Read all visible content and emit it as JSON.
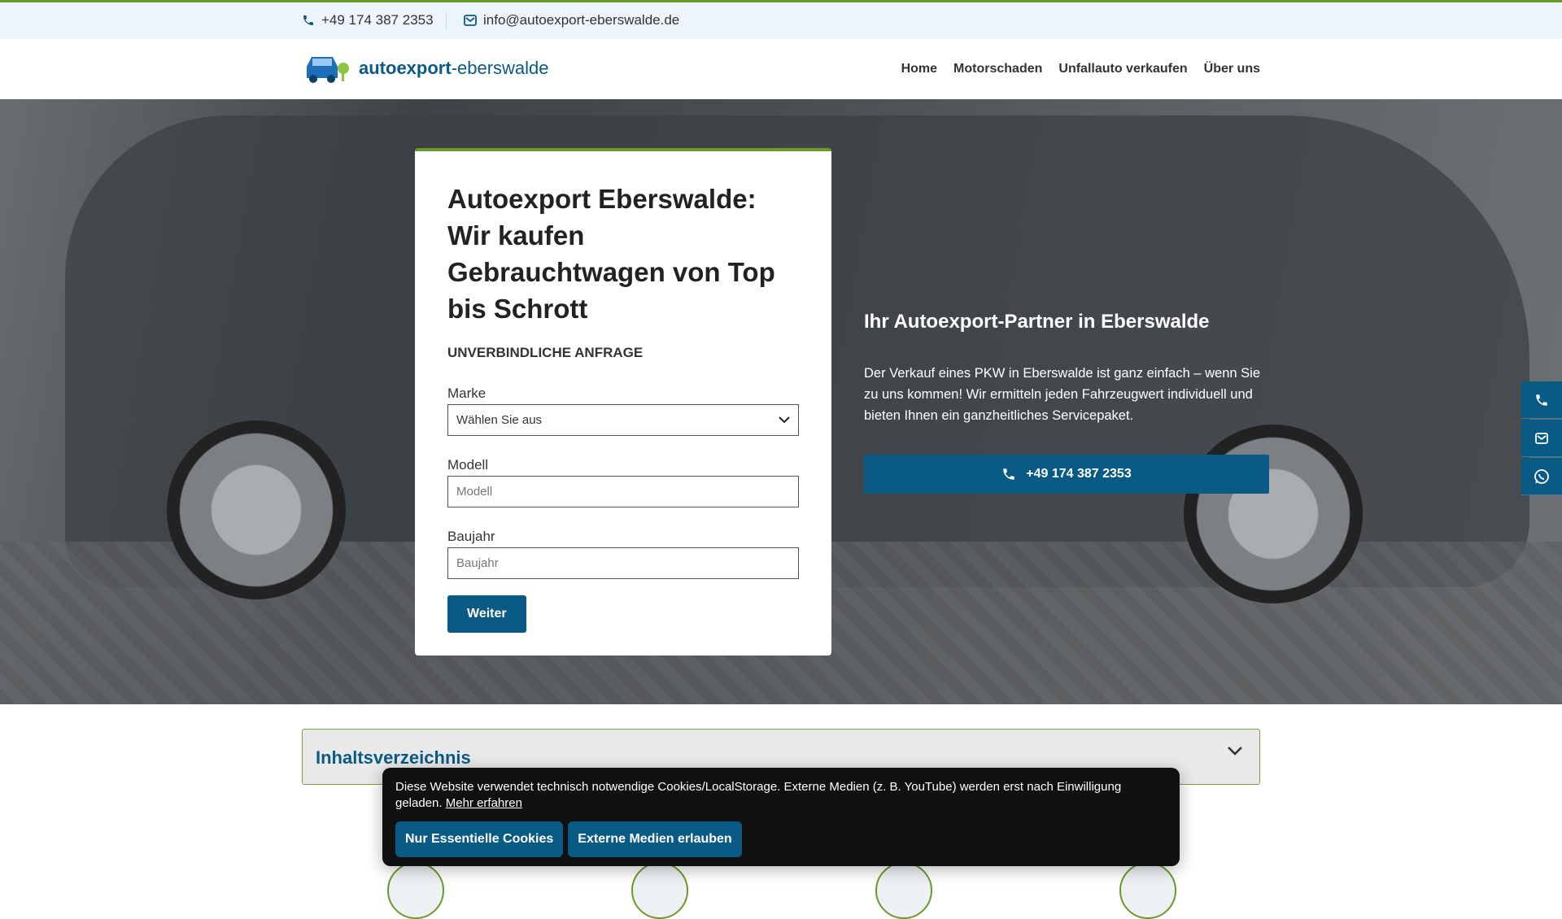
{
  "topbar": {
    "phone": "+49 174 387 2353",
    "email": "info@autoexport-eberswalde.de"
  },
  "header": {
    "logo_bold": "autoexport",
    "logo_light": "-eberswalde",
    "nav": [
      "Home",
      "Motorschaden",
      "Unfallauto verkaufen",
      "Über uns"
    ]
  },
  "form": {
    "title": "Autoexport Eberswalde: Wir kaufen Gebrauchtwagen von Top bis Schrott",
    "subtitle": "UNVERBINDLICHE ANFRAGE",
    "marke_label": "Marke",
    "marke_value": "Wählen Sie aus",
    "modell_label": "Modell",
    "modell_placeholder": "Modell",
    "baujahr_label": "Baujahr",
    "baujahr_placeholder": "Baujahr",
    "submit": "Weiter"
  },
  "hero": {
    "heading": "Ihr Autoexport-Partner in Eberswalde",
    "text": "Der Verkauf eines PKW in Eberswalde ist ganz einfach – wenn Sie zu uns kommen! Wir ermitteln jeden Fahrzeugwert individuell und bieten Ihnen ein ganzheitliches Servicepaket.",
    "cta": "+49 174 387 2353"
  },
  "toc": {
    "title": "Inhaltsverzeichnis"
  },
  "cookie": {
    "text": "Diese Website verwendet technisch notwendige Cookies/LocalStorage. Externe Medien (z. B. YouTube) werden erst nach Einwilligung geladen.",
    "link": "Mehr erfahren",
    "btn_essential": "Nur Essentielle Cookies",
    "btn_external": "Externe Medien erlauben"
  },
  "colors": {
    "primary": "#0a5a86",
    "accent": "#6a9a2a"
  }
}
